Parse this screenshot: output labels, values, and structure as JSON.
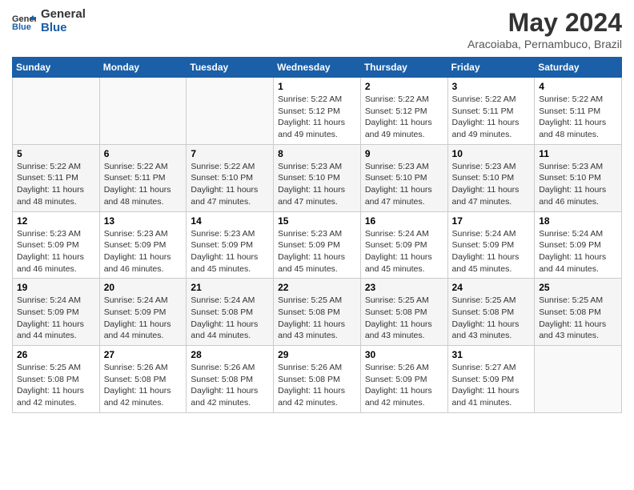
{
  "logo": {
    "line1": "General",
    "line2": "Blue"
  },
  "title": {
    "month_year": "May 2024",
    "location": "Aracoiaba, Pernambuco, Brazil"
  },
  "days_of_week": [
    "Sunday",
    "Monday",
    "Tuesday",
    "Wednesday",
    "Thursday",
    "Friday",
    "Saturday"
  ],
  "weeks": [
    [
      {
        "day": "",
        "info": ""
      },
      {
        "day": "",
        "info": ""
      },
      {
        "day": "",
        "info": ""
      },
      {
        "day": "1",
        "info": "Sunrise: 5:22 AM\nSunset: 5:12 PM\nDaylight: 11 hours and 49 minutes."
      },
      {
        "day": "2",
        "info": "Sunrise: 5:22 AM\nSunset: 5:12 PM\nDaylight: 11 hours and 49 minutes."
      },
      {
        "day": "3",
        "info": "Sunrise: 5:22 AM\nSunset: 5:11 PM\nDaylight: 11 hours and 49 minutes."
      },
      {
        "day": "4",
        "info": "Sunrise: 5:22 AM\nSunset: 5:11 PM\nDaylight: 11 hours and 48 minutes."
      }
    ],
    [
      {
        "day": "5",
        "info": "Sunrise: 5:22 AM\nSunset: 5:11 PM\nDaylight: 11 hours and 48 minutes."
      },
      {
        "day": "6",
        "info": "Sunrise: 5:22 AM\nSunset: 5:11 PM\nDaylight: 11 hours and 48 minutes."
      },
      {
        "day": "7",
        "info": "Sunrise: 5:22 AM\nSunset: 5:10 PM\nDaylight: 11 hours and 47 minutes."
      },
      {
        "day": "8",
        "info": "Sunrise: 5:23 AM\nSunset: 5:10 PM\nDaylight: 11 hours and 47 minutes."
      },
      {
        "day": "9",
        "info": "Sunrise: 5:23 AM\nSunset: 5:10 PM\nDaylight: 11 hours and 47 minutes."
      },
      {
        "day": "10",
        "info": "Sunrise: 5:23 AM\nSunset: 5:10 PM\nDaylight: 11 hours and 47 minutes."
      },
      {
        "day": "11",
        "info": "Sunrise: 5:23 AM\nSunset: 5:10 PM\nDaylight: 11 hours and 46 minutes."
      }
    ],
    [
      {
        "day": "12",
        "info": "Sunrise: 5:23 AM\nSunset: 5:09 PM\nDaylight: 11 hours and 46 minutes."
      },
      {
        "day": "13",
        "info": "Sunrise: 5:23 AM\nSunset: 5:09 PM\nDaylight: 11 hours and 46 minutes."
      },
      {
        "day": "14",
        "info": "Sunrise: 5:23 AM\nSunset: 5:09 PM\nDaylight: 11 hours and 45 minutes."
      },
      {
        "day": "15",
        "info": "Sunrise: 5:23 AM\nSunset: 5:09 PM\nDaylight: 11 hours and 45 minutes."
      },
      {
        "day": "16",
        "info": "Sunrise: 5:24 AM\nSunset: 5:09 PM\nDaylight: 11 hours and 45 minutes."
      },
      {
        "day": "17",
        "info": "Sunrise: 5:24 AM\nSunset: 5:09 PM\nDaylight: 11 hours and 45 minutes."
      },
      {
        "day": "18",
        "info": "Sunrise: 5:24 AM\nSunset: 5:09 PM\nDaylight: 11 hours and 44 minutes."
      }
    ],
    [
      {
        "day": "19",
        "info": "Sunrise: 5:24 AM\nSunset: 5:09 PM\nDaylight: 11 hours and 44 minutes."
      },
      {
        "day": "20",
        "info": "Sunrise: 5:24 AM\nSunset: 5:09 PM\nDaylight: 11 hours and 44 minutes."
      },
      {
        "day": "21",
        "info": "Sunrise: 5:24 AM\nSunset: 5:08 PM\nDaylight: 11 hours and 44 minutes."
      },
      {
        "day": "22",
        "info": "Sunrise: 5:25 AM\nSunset: 5:08 PM\nDaylight: 11 hours and 43 minutes."
      },
      {
        "day": "23",
        "info": "Sunrise: 5:25 AM\nSunset: 5:08 PM\nDaylight: 11 hours and 43 minutes."
      },
      {
        "day": "24",
        "info": "Sunrise: 5:25 AM\nSunset: 5:08 PM\nDaylight: 11 hours and 43 minutes."
      },
      {
        "day": "25",
        "info": "Sunrise: 5:25 AM\nSunset: 5:08 PM\nDaylight: 11 hours and 43 minutes."
      }
    ],
    [
      {
        "day": "26",
        "info": "Sunrise: 5:25 AM\nSunset: 5:08 PM\nDaylight: 11 hours and 42 minutes."
      },
      {
        "day": "27",
        "info": "Sunrise: 5:26 AM\nSunset: 5:08 PM\nDaylight: 11 hours and 42 minutes."
      },
      {
        "day": "28",
        "info": "Sunrise: 5:26 AM\nSunset: 5:08 PM\nDaylight: 11 hours and 42 minutes."
      },
      {
        "day": "29",
        "info": "Sunrise: 5:26 AM\nSunset: 5:08 PM\nDaylight: 11 hours and 42 minutes."
      },
      {
        "day": "30",
        "info": "Sunrise: 5:26 AM\nSunset: 5:09 PM\nDaylight: 11 hours and 42 minutes."
      },
      {
        "day": "31",
        "info": "Sunrise: 5:27 AM\nSunset: 5:09 PM\nDaylight: 11 hours and 41 minutes."
      },
      {
        "day": "",
        "info": ""
      }
    ]
  ]
}
